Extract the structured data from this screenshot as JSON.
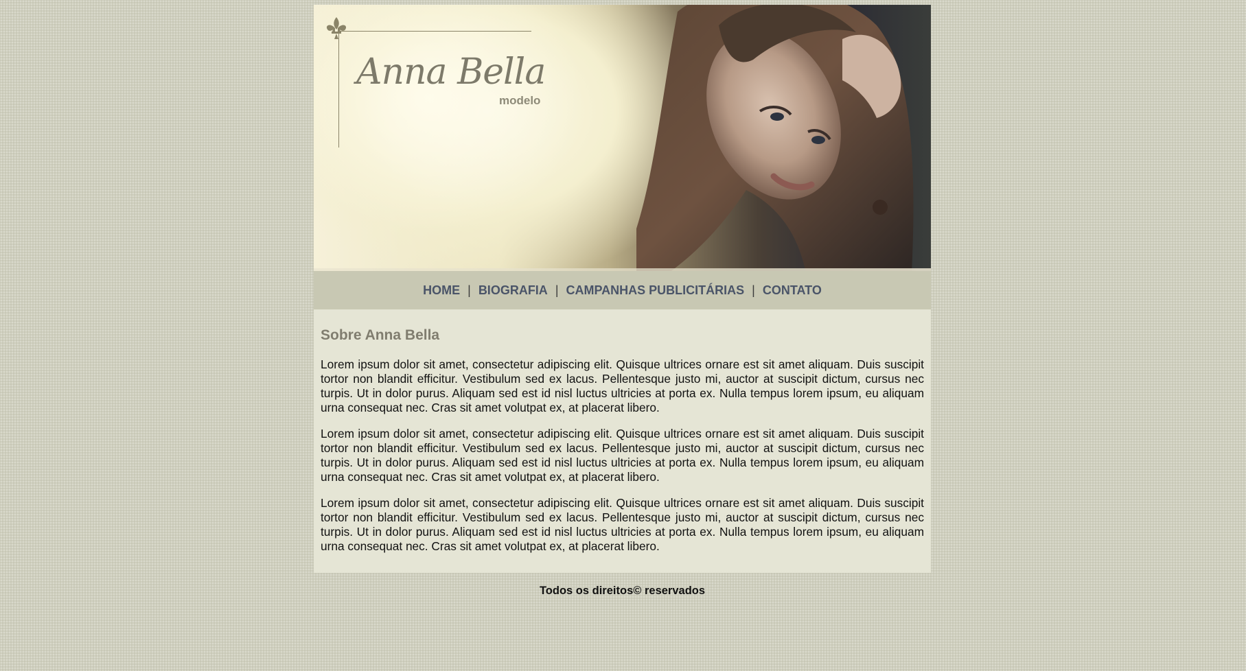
{
  "header": {
    "logo_name": "Anna Bella",
    "logo_sub": "modelo"
  },
  "nav": {
    "items": [
      {
        "label": "HOME"
      },
      {
        "label": "BIOGRAFIA"
      },
      {
        "label": "CAMPANHAS PUBLICITÁRIAS"
      },
      {
        "label": "CONTATO"
      }
    ],
    "separator": "|"
  },
  "content": {
    "title": "Sobre Anna Bella",
    "paragraphs": [
      "Lorem ipsum dolor sit amet, consectetur adipiscing elit. Quisque ultrices ornare est sit amet aliquam. Duis suscipit tortor non blandit efficitur. Vestibulum sed ex lacus. Pellentesque justo mi, auctor at suscipit dictum, cursus nec turpis. Ut in dolor purus. Aliquam sed est id nisl luctus ultricies at porta ex. Nulla tempus lorem ipsum, eu aliquam urna consequat nec. Cras sit amet volutpat ex, at placerat libero.",
      "Lorem ipsum dolor sit amet, consectetur adipiscing elit. Quisque ultrices ornare est sit amet aliquam. Duis suscipit tortor non blandit efficitur. Vestibulum sed ex lacus. Pellentesque justo mi, auctor at suscipit dictum, cursus nec turpis. Ut in dolor purus. Aliquam sed est id nisl luctus ultricies at porta ex. Nulla tempus lorem ipsum, eu aliquam urna consequat nec. Cras sit amet volutpat ex, at placerat libero.",
      "Lorem ipsum dolor sit amet, consectetur adipiscing elit. Quisque ultrices ornare est sit amet aliquam. Duis suscipit tortor non blandit efficitur. Vestibulum sed ex lacus. Pellentesque justo mi, auctor at suscipit dictum, cursus nec turpis. Ut in dolor purus. Aliquam sed est id nisl luctus ultricies at porta ex. Nulla tempus lorem ipsum, eu aliquam urna consequat nec. Cras sit amet volutpat ex, at placerat libero."
    ]
  },
  "footer": {
    "text": "Todos os direitos© reservados"
  },
  "colors": {
    "page_background": "#cfcfbe",
    "nav_background": "#c8c8b3",
    "nav_text": "#4a5468",
    "content_background": "#e5e5d5",
    "title_color": "#807d6f"
  },
  "icons": {
    "logo_ornament": "fleur-de-lis-icon"
  }
}
